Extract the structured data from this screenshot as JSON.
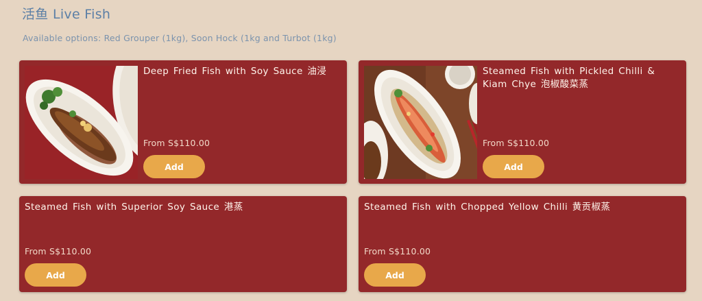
{
  "section": {
    "title": "活鱼 Live Fish",
    "subtitle": "Available options: Red Grouper (1kg), Soon Hock (1kg and Turbot (1kg)"
  },
  "items": [
    {
      "title": "Deep Fried Fish with Soy Sauce 油浸",
      "price": "From S$110.00",
      "add_label": "Add",
      "image": "fried-fish-photo"
    },
    {
      "title": "Steamed Fish with Pickled Chilli & Kiam Chye 泡椒酸菜蒸",
      "price": "From S$110.00",
      "add_label": "Add",
      "image": "steamed-fish-photo"
    },
    {
      "title": "Steamed Fish with Superior Soy Sauce 港蒸",
      "price": "From S$110.00",
      "add_label": "Add"
    },
    {
      "title": "Steamed Fish with Chopped Yellow Chilli 黄贡椒蒸",
      "price": "From S$110.00",
      "add_label": "Add"
    }
  ],
  "colors": {
    "background": "#e6d5c2",
    "card": "#93282a",
    "button": "#e8a84a",
    "heading": "#5b7fa6"
  }
}
